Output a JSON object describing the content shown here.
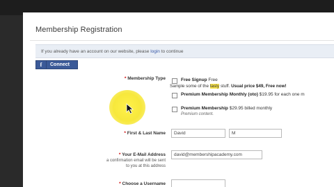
{
  "page": {
    "title": "Membership Registration",
    "info_prefix": "If you already have an account on our website, please ",
    "info_link": "login",
    "info_suffix": " to continue"
  },
  "connect_button": {
    "label": "Connect",
    "icon": "facebook-icon"
  },
  "membership_type": {
    "label": "Membership Type",
    "options": [
      {
        "name": "Free Signup",
        "suffix": " Free",
        "desc_prefix": "Sample some of the ",
        "desc_highlight": "tasty",
        "desc_suffix": " stuff. ",
        "desc_bold": "Usual price $49, Free now!"
      },
      {
        "name": "Premium Membership Monthly (oto)",
        "suffix": " $19.95 for each one m"
      },
      {
        "name": "Premium Membership",
        "suffix": " $29.95 billed monthly",
        "desc": "Premium content."
      }
    ]
  },
  "name_field": {
    "label": "First & Last Name",
    "first": "David",
    "last": "M"
  },
  "email_field": {
    "label": "Your E-Mail Address",
    "hint_line1": "a confirmation email will be sent",
    "hint_line2": "to you at this address",
    "value": "david@membershipacademy.com"
  },
  "username_field": {
    "label": "Choose a Username",
    "value": ""
  },
  "colors": {
    "facebook": "#3b5a98",
    "highlight": "#f6e24a",
    "required": "#cc0000"
  }
}
